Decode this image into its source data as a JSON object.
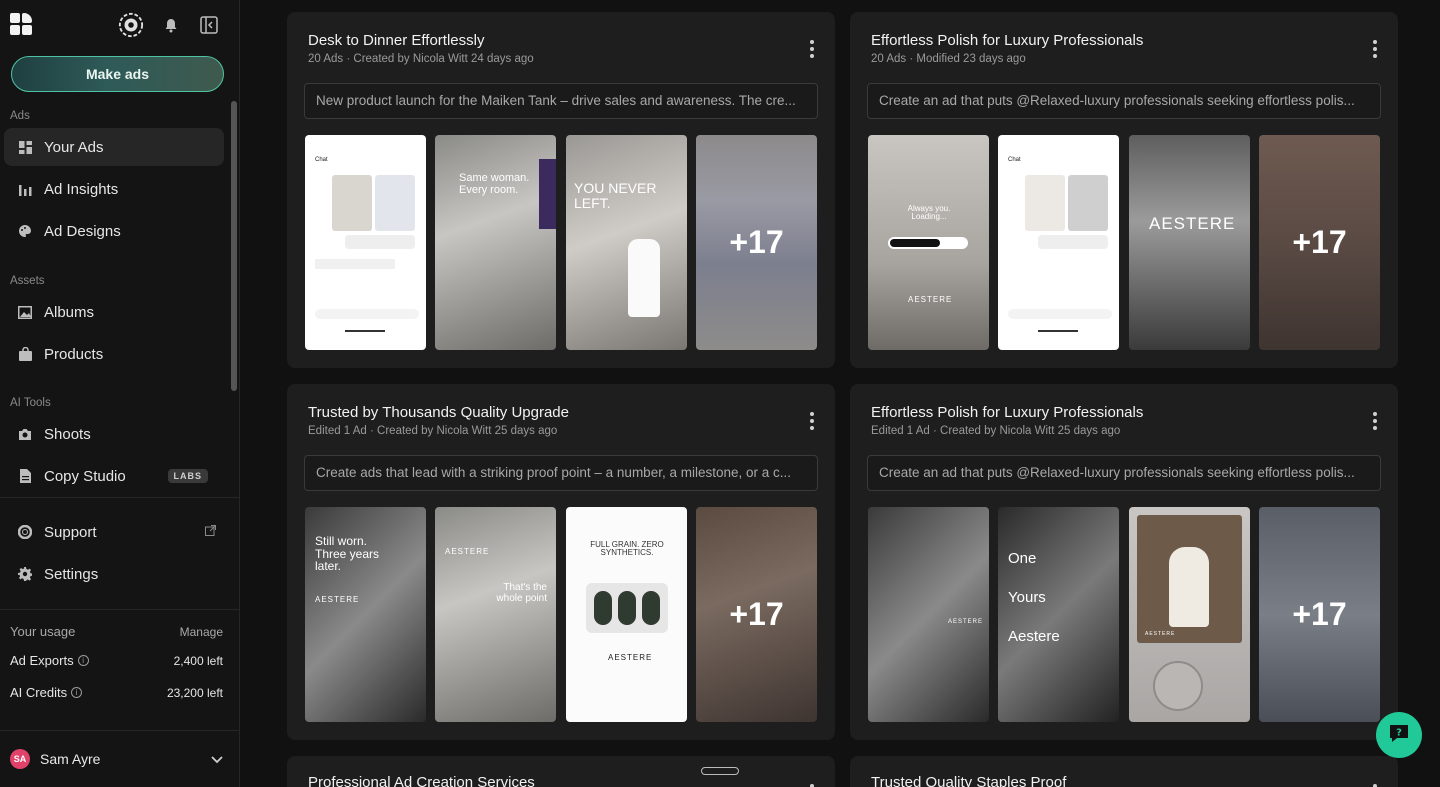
{
  "sidebar": {
    "make_ads": "Make ads",
    "sections": {
      "ads": "Ads",
      "assets": "Assets",
      "ai_tools": "AI Tools"
    },
    "items": {
      "your_ads": "Your Ads",
      "ad_insights": "Ad Insights",
      "ad_designs": "Ad Designs",
      "albums": "Albums",
      "products": "Products",
      "shoots": "Shoots",
      "copy_studio": "Copy Studio",
      "labs_badge": "LABS",
      "support": "Support",
      "settings": "Settings"
    },
    "usage": {
      "title": "Your usage",
      "manage": "Manage",
      "ad_exports_label": "Ad Exports",
      "ad_exports_value": "2,400 left",
      "ai_credits_label": "AI Credits",
      "ai_credits_value": "23,200 left"
    },
    "user": {
      "initials": "SA",
      "name": "Sam Ayre"
    }
  },
  "cards": [
    {
      "title": "Desk to Dinner Effortlessly",
      "meta": "20 Ads · Created by Nicola Witt 24 days ago",
      "prompt": "New product launch for the Maiken Tank – drive sales and awareness. The cre...",
      "thumbs": [
        "Chat",
        "Same woman. Every room.",
        "YOU NEVER LEFT.",
        "+17"
      ]
    },
    {
      "title": "Effortless Polish for Luxury Professionals",
      "meta": "20 Ads · Modified 23 days ago",
      "prompt": "Create an ad that puts @Relaxed-luxury professionals seeking effortless polis...",
      "thumbs": [
        "Always you. Loading...",
        "Chat",
        "AESTERE",
        "+17"
      ]
    },
    {
      "title": "Trusted by Thousands Quality Upgrade",
      "meta": "Edited 1 Ad · Created by Nicola Witt 25 days ago",
      "prompt": "Create ads that lead with a striking proof point – a number, a milestone, or a c...",
      "thumbs": [
        "Still worn. Three years later.",
        "That's the whole point",
        "FULL GRAIN. ZERO SYNTHETICS.",
        "+17"
      ]
    },
    {
      "title": "Effortless Polish for Luxury Professionals",
      "meta": "Edited 1 Ad · Created by Nicola Witt 25 days ago",
      "prompt": "Create an ad that puts @Relaxed-luxury professionals seeking effortless polis...",
      "thumbs": [
        "AESTERE",
        "One Yours Aestere",
        "AESTERE",
        "+17"
      ]
    },
    {
      "title": "Professional Ad Creation Services"
    },
    {
      "title": "Trusted Quality Staples Proof"
    }
  ],
  "brand_word": "AESTERE",
  "colors": {
    "accent": "#20c997",
    "card_bg": "#1e1e1e",
    "page_bg": "#111111"
  }
}
